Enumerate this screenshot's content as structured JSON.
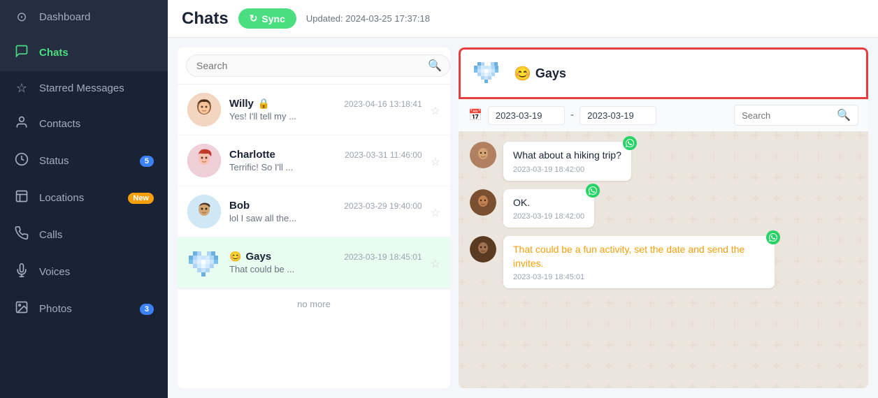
{
  "sidebar": {
    "items": [
      {
        "id": "dashboard",
        "label": "Dashboard",
        "icon": "⊙",
        "active": false
      },
      {
        "id": "chats",
        "label": "Chats",
        "icon": "💬",
        "active": true
      },
      {
        "id": "starred",
        "label": "Starred Messages",
        "icon": "☆",
        "active": false
      },
      {
        "id": "contacts",
        "label": "Contacts",
        "icon": "👤",
        "active": false
      },
      {
        "id": "status",
        "label": "Status",
        "icon": "↻",
        "active": false,
        "badge": "5"
      },
      {
        "id": "locations",
        "label": "Locations",
        "icon": "📋",
        "active": false,
        "badge": "New"
      },
      {
        "id": "calls",
        "label": "Calls",
        "icon": "📞",
        "active": false
      },
      {
        "id": "voices",
        "label": "Voices",
        "icon": "🎤",
        "active": false
      },
      {
        "id": "photos",
        "label": "Photos",
        "icon": "🖼",
        "active": false,
        "badge": "3"
      }
    ]
  },
  "header": {
    "title": "Chats",
    "sync_label": "Sync",
    "sync_icon": "↻",
    "updated_text": "Updated: 2024-03-25 17:37:18"
  },
  "chat_list": {
    "search_placeholder": "Search",
    "no_more": "no more",
    "items": [
      {
        "id": "willy",
        "name": "Willy",
        "preview": "Yes! I'll tell my ...",
        "time": "2023-04-16 13:18:41",
        "has_pin": true
      },
      {
        "id": "charlotte",
        "name": "Charlotte",
        "preview": "Terrific! So I'll ...",
        "time": "2023-03-31 11:46:00",
        "has_pin": false
      },
      {
        "id": "bob",
        "name": "Bob",
        "preview": "lol I saw all the...",
        "time": "2023-03-29 19:40:00",
        "has_pin": false
      },
      {
        "id": "gays",
        "name": "Gays",
        "preview": "That could be ...",
        "time": "2023-03-19 18:45:01",
        "has_pin": false,
        "active": true
      }
    ]
  },
  "chat_detail": {
    "group_name": "Gays",
    "group_emoji": "😊",
    "date_from": "2023-03-19",
    "date_to": "2023-03-19",
    "search_placeholder": "Search",
    "messages": [
      {
        "id": "msg1",
        "text": "What about a hiking trip?",
        "time": "2023-03-19 18:42:00",
        "has_wa": true
      },
      {
        "id": "msg2",
        "text": "OK.",
        "time": "2023-03-19 18:42:00",
        "has_wa": true
      },
      {
        "id": "msg3",
        "text": "That could be a fun activity, set the date and send the invites.",
        "time": "2023-03-19 18:45:01",
        "has_wa": true,
        "text_color": "orange"
      }
    ]
  }
}
